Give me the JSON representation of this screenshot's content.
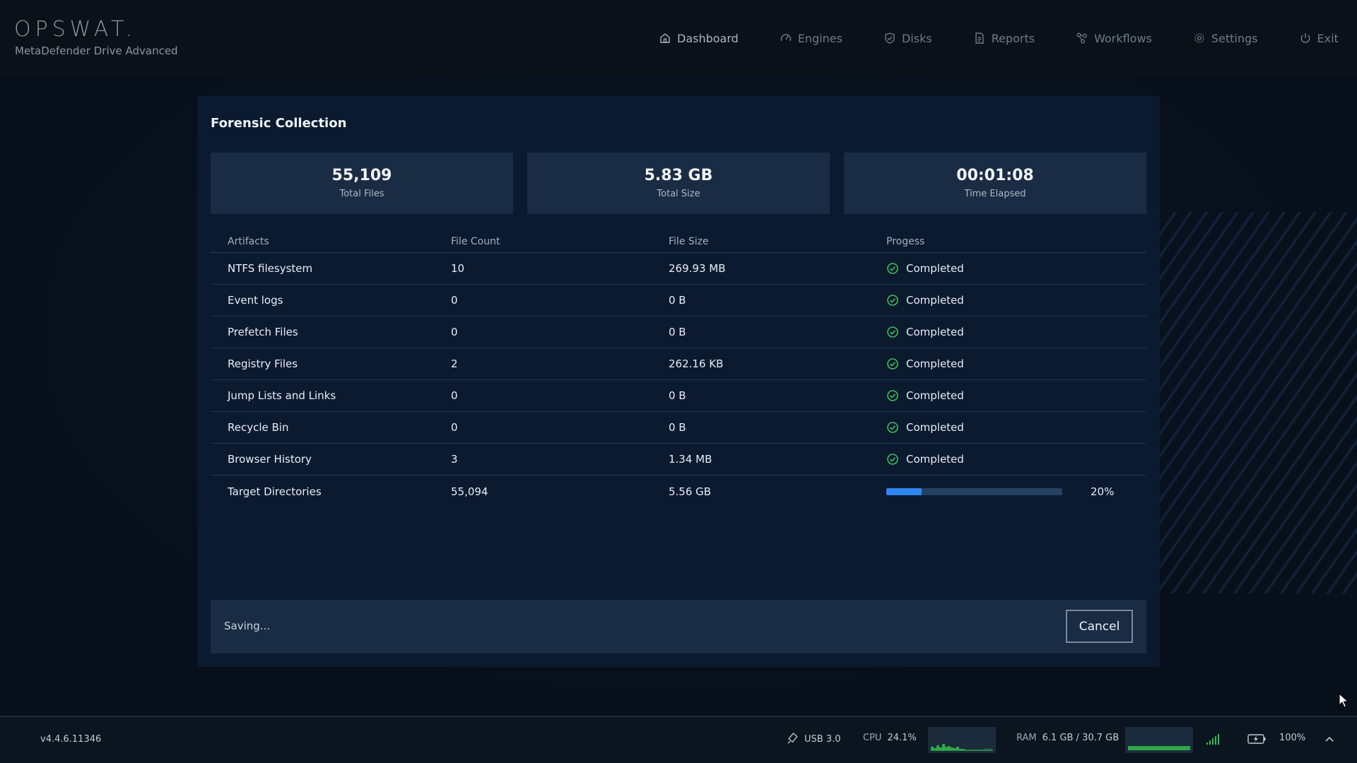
{
  "header": {
    "logo": "OPSWAT.",
    "product": "MetaDefender Drive Advanced",
    "nav": [
      {
        "label": "Dashboard",
        "icon": "home-icon",
        "active": true
      },
      {
        "label": "Engines",
        "icon": "gauge-icon",
        "active": false
      },
      {
        "label": "Disks",
        "icon": "shield-check-icon",
        "active": false
      },
      {
        "label": "Reports",
        "icon": "document-icon",
        "active": false
      },
      {
        "label": "Workflows",
        "icon": "workflow-icon",
        "active": false
      },
      {
        "label": "Settings",
        "icon": "gear-icon",
        "active": false
      },
      {
        "label": "Exit",
        "icon": "power-icon",
        "active": false
      }
    ]
  },
  "modal": {
    "title": "Forensic Collection",
    "stats": [
      {
        "value": "55,109",
        "label": "Total Files"
      },
      {
        "value": "5.83 GB",
        "label": "Total Size"
      },
      {
        "value": "00:01:08",
        "label": "Time Elapsed"
      }
    ],
    "columns": [
      "Artifacts",
      "File Count",
      "File Size",
      "Progess"
    ],
    "rows": [
      {
        "artifact": "NTFS filesystem",
        "count": "10",
        "size": "269.93 MB",
        "status": "Completed"
      },
      {
        "artifact": "Event logs",
        "count": "0",
        "size": "0 B",
        "status": "Completed"
      },
      {
        "artifact": "Prefetch Files",
        "count": "0",
        "size": "0 B",
        "status": "Completed"
      },
      {
        "artifact": "Registry Files",
        "count": "2",
        "size": "262.16 KB",
        "status": "Completed"
      },
      {
        "artifact": "Jump Lists and Links",
        "count": "0",
        "size": "0 B",
        "status": "Completed"
      },
      {
        "artifact": "Recycle Bin",
        "count": "0",
        "size": "0 B",
        "status": "Completed"
      },
      {
        "artifact": "Browser History",
        "count": "3",
        "size": "1.34 MB",
        "status": "Completed"
      }
    ],
    "active_row": {
      "artifact": "Target Directories",
      "count": "55,094",
      "size": "5.56 GB",
      "progress": 0.2,
      "progress_label": "20%"
    },
    "footer": {
      "status": "Saving...",
      "cancel_label": "Cancel"
    }
  },
  "statusbar": {
    "version": "v4.4.6.11346",
    "usb": "USB 3.0",
    "cpu_label": "CPU",
    "cpu_value": "24.1%",
    "ram_label": "RAM",
    "ram_value": "6.1 GB / 30.7 GB",
    "battery": "100%"
  },
  "colors": {
    "accent": "#2f86f0",
    "success": "#3fbf5a",
    "modal_bg": "#0b1a2f",
    "card_bg": "#1a2c43"
  }
}
